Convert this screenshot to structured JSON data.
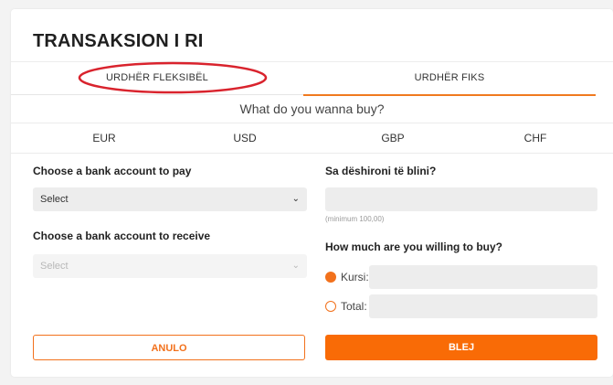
{
  "page": {
    "title": "TRANSAKSION I RI"
  },
  "tabs": [
    {
      "label": "URDHËR FLEKSIBËL"
    },
    {
      "label": "URDHËR FIKS"
    }
  ],
  "buy_prompt": "What do you wanna buy?",
  "currencies": [
    "EUR",
    "USD",
    "GBP",
    "CHF"
  ],
  "left": {
    "pay_label": "Choose a bank account to pay",
    "pay_select_value": "Select",
    "receive_label": "Choose a bank account to receive",
    "receive_select_value": "Select"
  },
  "right": {
    "amount_label": "Sa dëshironi të blini?",
    "amount_value": "",
    "amount_hint": "(minimum 100,00)",
    "willing_label": "How much are you willing to buy?",
    "options": [
      {
        "label": "Kursi:",
        "selected": true,
        "value": ""
      },
      {
        "label": "Total:",
        "selected": false,
        "value": ""
      }
    ]
  },
  "buttons": {
    "cancel": "ANULO",
    "buy": "BLEJ"
  },
  "colors": {
    "accent": "#f96b06",
    "annotation": "#d9232d"
  }
}
